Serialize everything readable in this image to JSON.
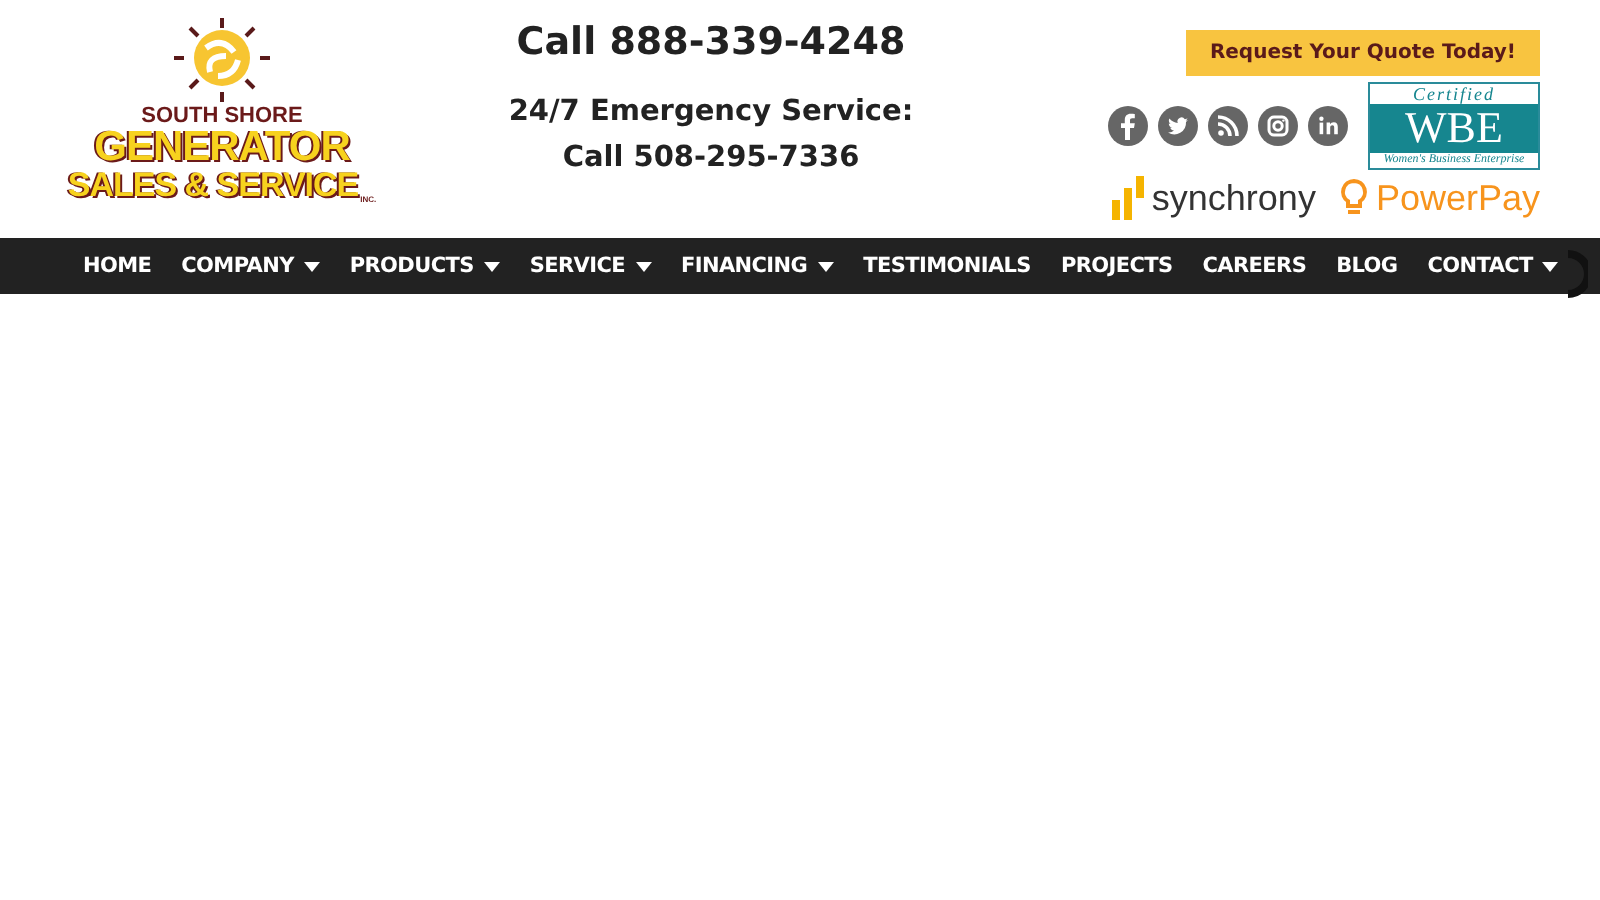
{
  "logo": {
    "line_1": "SOUTH SHORE",
    "line_2": "GENERATOR",
    "line_3": "SALES & SERVICE",
    "suffix": "INC."
  },
  "phone": "Call 888-339-4248",
  "emergency": {
    "title": "24/7 Emergency Service:",
    "phone": "Call 508-295-7336"
  },
  "quote_button": "Request Your Quote Today!",
  "social": [
    {
      "kind": "facebook"
    },
    {
      "kind": "twitter"
    },
    {
      "kind": "rss"
    },
    {
      "kind": "instagram"
    },
    {
      "kind": "linkedin"
    }
  ],
  "wbe_badge": {
    "top": "Certified",
    "main": "WBE",
    "bottom": "Women's Business Enterprise"
  },
  "partners": [
    {
      "kind": "synchrony",
      "name": "synchrony"
    },
    {
      "kind": "powerpay",
      "name": "PowerPay"
    }
  ],
  "nav": [
    {
      "label": "HOME",
      "dropdown": false
    },
    {
      "label": "COMPANY",
      "dropdown": true
    },
    {
      "label": "PRODUCTS",
      "dropdown": true
    },
    {
      "label": "SERVICE",
      "dropdown": true
    },
    {
      "label": "FINANCING",
      "dropdown": true
    },
    {
      "label": "TESTIMONIALS",
      "dropdown": false
    },
    {
      "label": "PROJECTS",
      "dropdown": false
    },
    {
      "label": "CAREERS",
      "dropdown": false
    },
    {
      "label": "BLOG",
      "dropdown": false
    },
    {
      "label": "CONTACT",
      "dropdown": true
    }
  ]
}
